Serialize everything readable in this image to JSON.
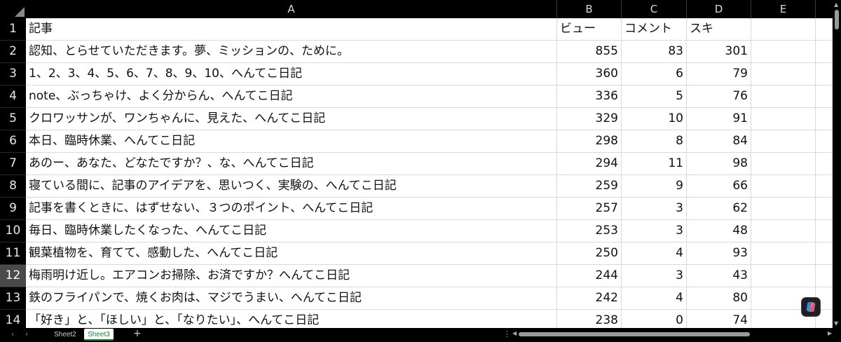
{
  "sheet": {
    "columns": [
      {
        "label": "A",
        "align": "left"
      },
      {
        "label": "B",
        "align": "right"
      },
      {
        "label": "C",
        "align": "right"
      },
      {
        "label": "D",
        "align": "right"
      },
      {
        "label": "E",
        "align": "left"
      }
    ],
    "rows": [
      {
        "num": "1",
        "cells": [
          "記事",
          "ビュー",
          "コメント",
          "スキ",
          ""
        ]
      },
      {
        "num": "2",
        "cells": [
          "認知、とらせていただきます。夢、ミッションの、ために。",
          "855",
          "83",
          "301",
          ""
        ]
      },
      {
        "num": "3",
        "cells": [
          "1、2、3、4、5、6、7、8、9、10、へんてこ日記",
          "360",
          "6",
          "79",
          ""
        ]
      },
      {
        "num": "4",
        "cells": [
          "note、ぶっちゃけ、よく分からん、へんてこ日記",
          "336",
          "5",
          "76",
          ""
        ]
      },
      {
        "num": "5",
        "cells": [
          "クロワッサンが、ワンちゃんに、見えた、へんてこ日記",
          "329",
          "10",
          "91",
          ""
        ]
      },
      {
        "num": "6",
        "cells": [
          "本日、臨時休業、へんてこ日記",
          "298",
          "8",
          "84",
          ""
        ]
      },
      {
        "num": "7",
        "cells": [
          "あのー、あなた、どなたですか？、な、へんてこ日記",
          "294",
          "11",
          "98",
          ""
        ]
      },
      {
        "num": "8",
        "cells": [
          "寝ている間に、記事のアイデアを、思いつく、実験の、へんてこ日記",
          "259",
          "9",
          "66",
          ""
        ]
      },
      {
        "num": "9",
        "cells": [
          "記事を書くときに、はずせない、３つのポイント、へんてこ日記",
          "257",
          "3",
          "62",
          ""
        ]
      },
      {
        "num": "10",
        "cells": [
          "毎日、臨時休業したくなった、へんてこ日記",
          "253",
          "3",
          "48",
          ""
        ]
      },
      {
        "num": "11",
        "cells": [
          "観葉植物を、育てて、感動した、へんてこ日記",
          "250",
          "4",
          "93",
          ""
        ]
      },
      {
        "num": "12",
        "cells": [
          "梅雨明け近し。エアコンお掃除、お済ですか？へんてこ日記",
          "244",
          "3",
          "43",
          ""
        ]
      },
      {
        "num": "13",
        "cells": [
          "鉄のフライパンで、焼くお肉は、マジでうまい、へんてこ日記",
          "242",
          "4",
          "80",
          ""
        ]
      },
      {
        "num": "14",
        "cells": [
          "「好き」と、「ほしい」と、「なりたい」、へんてこ日記",
          "238",
          "0",
          "74",
          ""
        ]
      }
    ],
    "selected_row": "12"
  },
  "tabs": {
    "items": [
      {
        "label": "Sheet2",
        "active": false
      },
      {
        "label": "Sheet3",
        "active": true
      }
    ],
    "add_label": "+"
  },
  "colors": {
    "accent": "#1a7f3c",
    "header_bg": "#000000",
    "grid_line": "#d9d9d9"
  },
  "icons": {
    "select_all": "corner-triangle-icon",
    "copilot": "copilot-icon"
  }
}
